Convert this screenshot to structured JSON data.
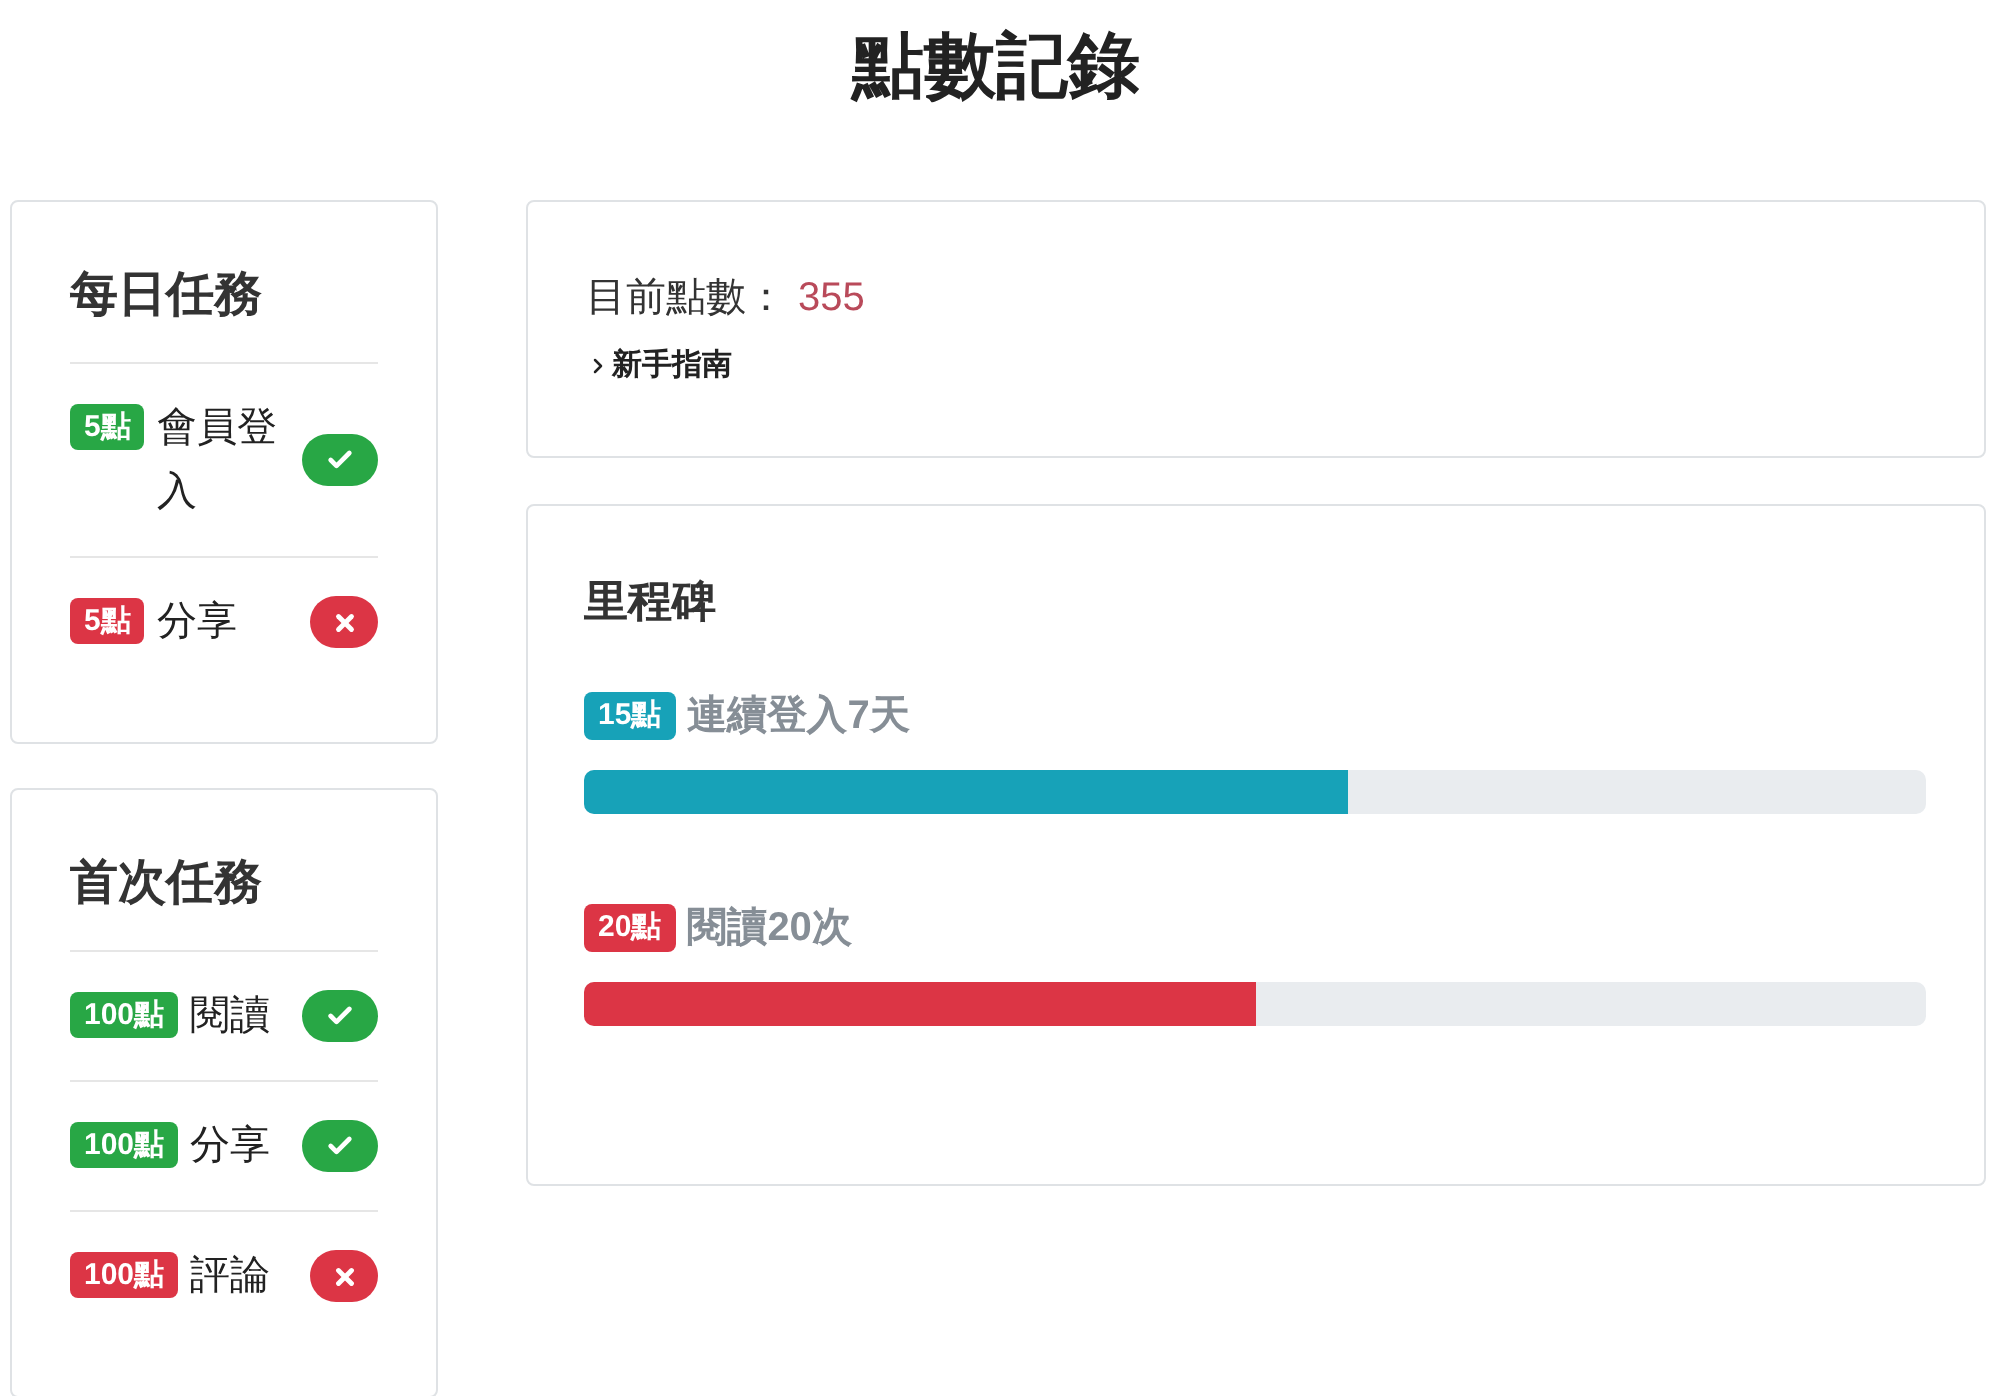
{
  "title": "點數記錄",
  "task_groups": [
    {
      "title": "每日任務",
      "tasks": [
        {
          "points": "5點",
          "name": "會員登入",
          "done": true
        },
        {
          "points": "5點",
          "name": "分享",
          "done": false
        }
      ]
    },
    {
      "title": "首次任務",
      "tasks": [
        {
          "points": "100點",
          "name": "閱讀",
          "done": true
        },
        {
          "points": "100點",
          "name": "分享",
          "done": true
        },
        {
          "points": "100點",
          "name": "評論",
          "done": false
        }
      ]
    }
  ],
  "points_summary": {
    "label": "目前點數：",
    "value": "355",
    "guide_link": "新手指南"
  },
  "milestones_panel": {
    "title": "里程碑",
    "milestones": [
      {
        "points": "15點",
        "name": "連續登入7天",
        "level": 0.57,
        "color": "#17a2b8"
      },
      {
        "points": "20點",
        "name": "閱讀20次",
        "level": 0.5,
        "color": "#dc3545"
      }
    ]
  }
}
